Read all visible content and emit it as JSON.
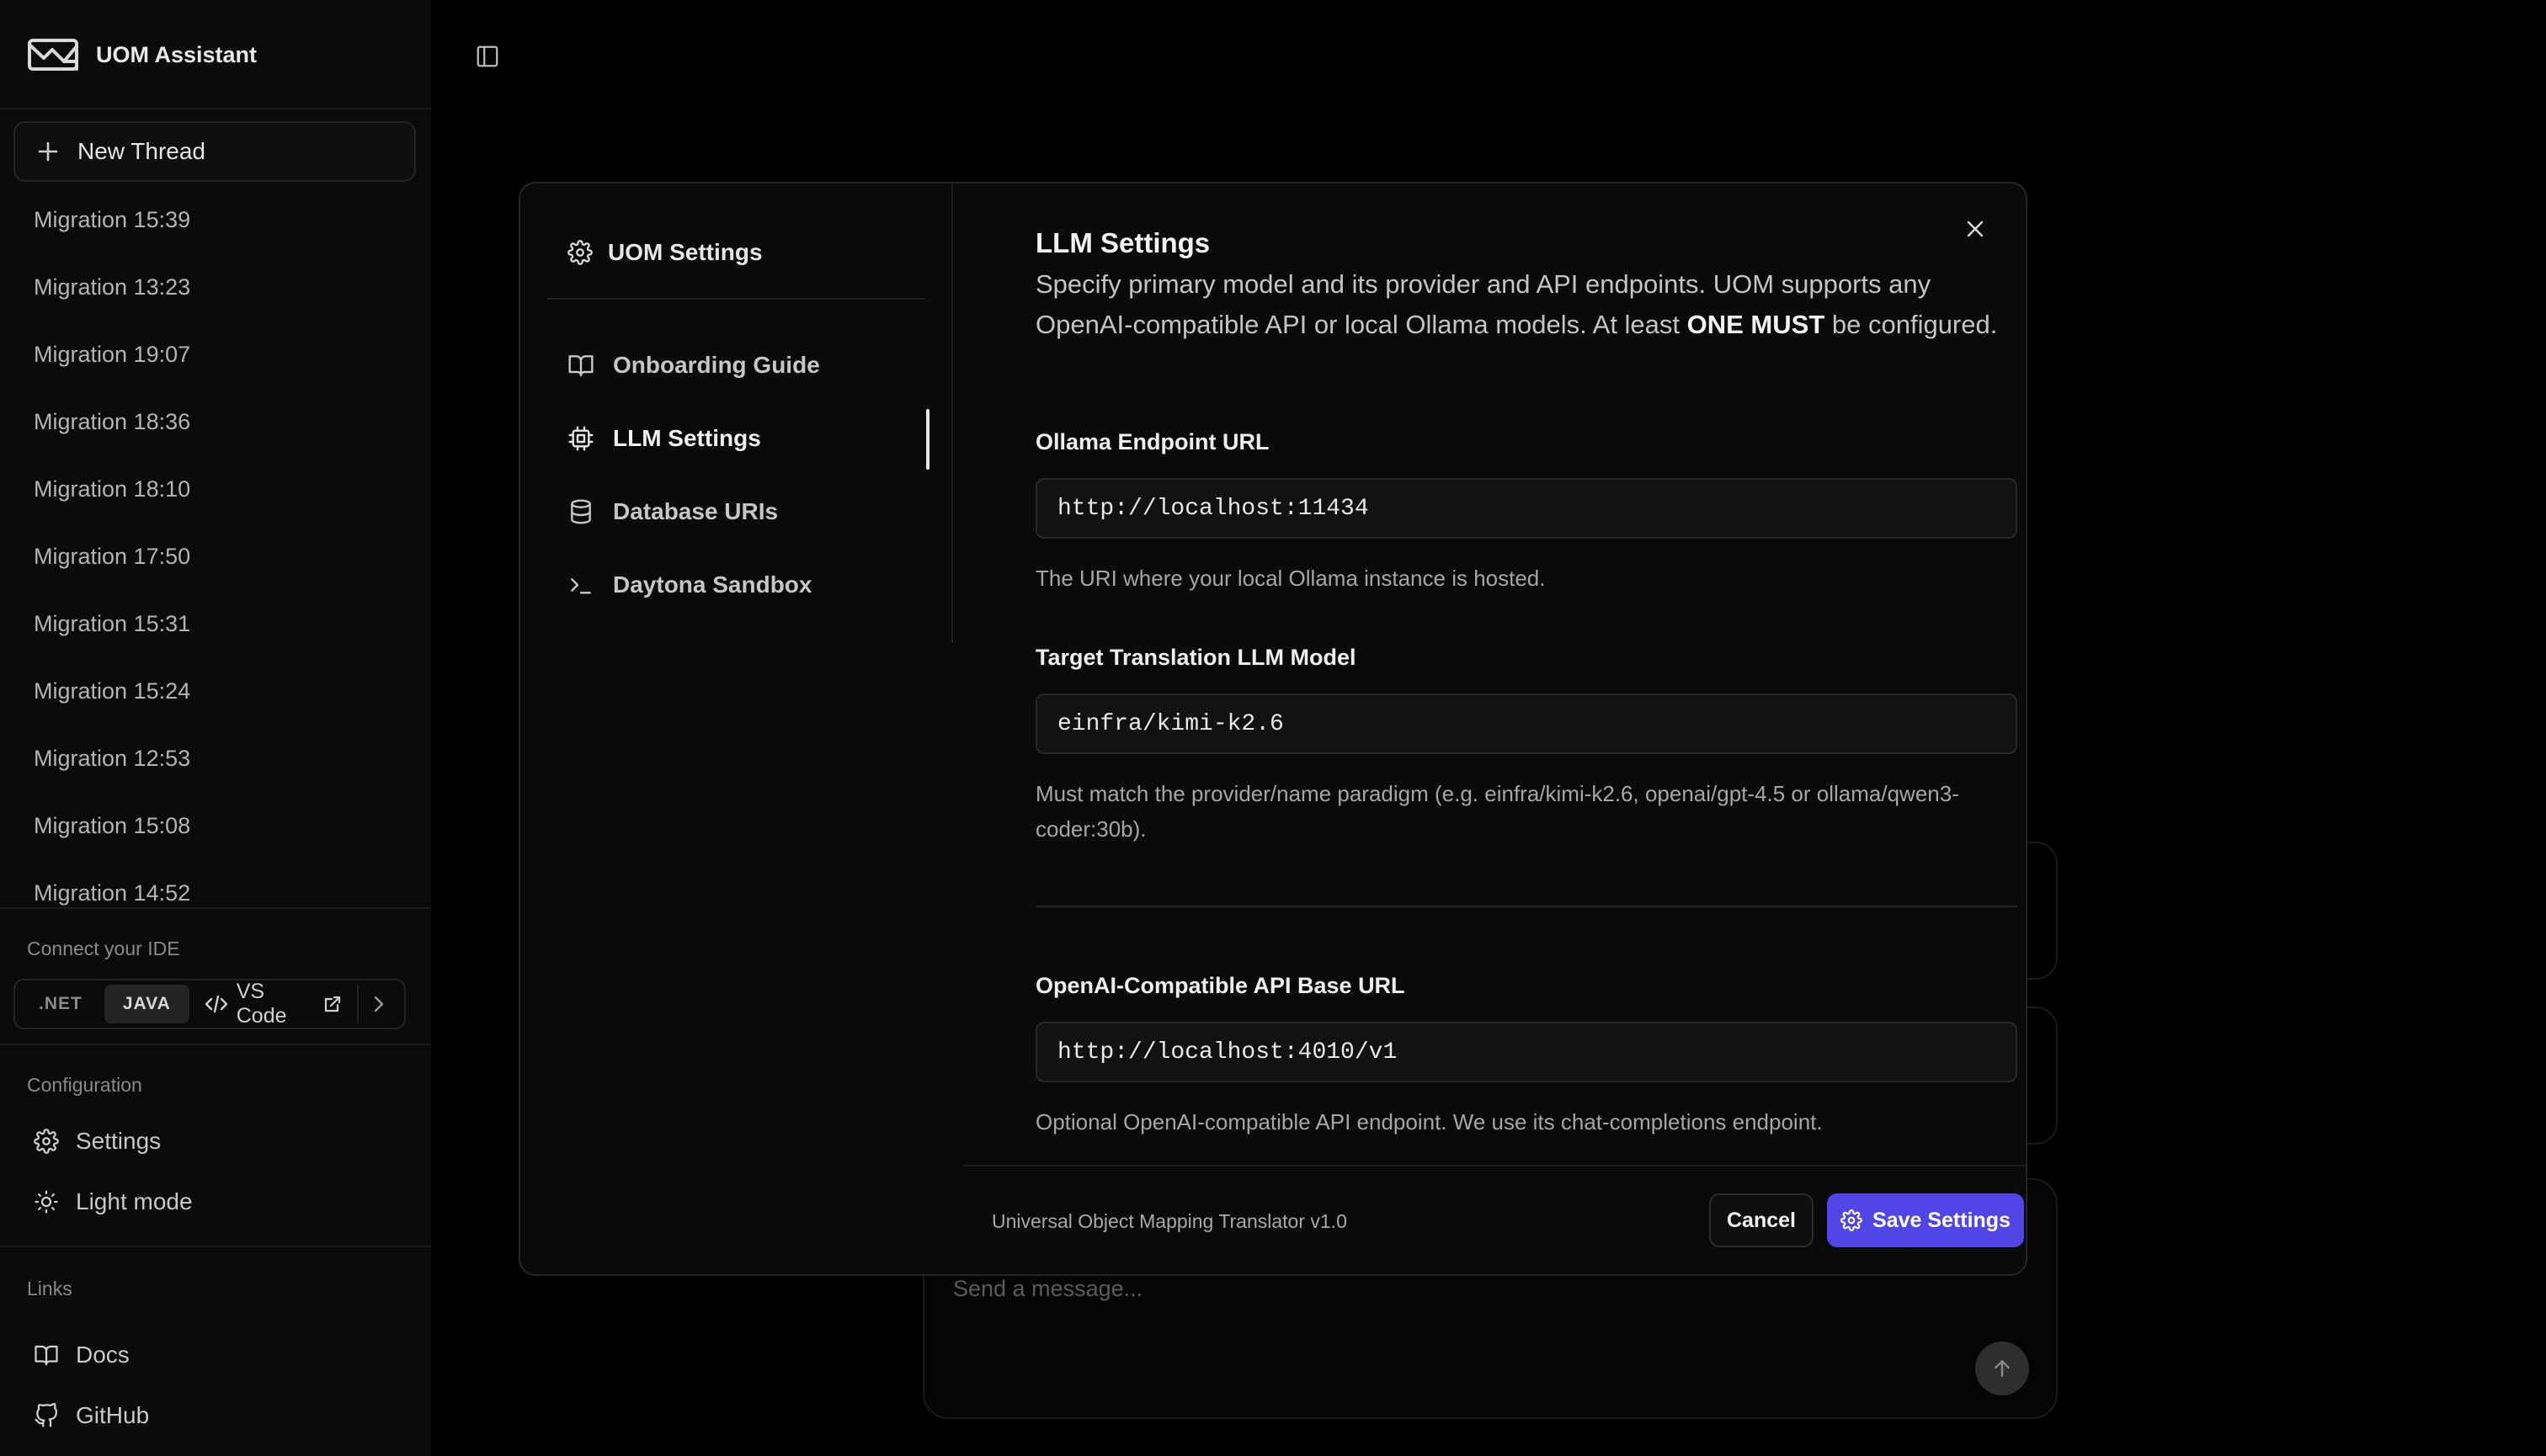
{
  "app": {
    "name": "UOM Assistant"
  },
  "sidebar": {
    "new_thread_label": "New Thread",
    "threads": [
      "Migration 15:39",
      "Migration 13:23",
      "Migration 19:07",
      "Migration 18:36",
      "Migration 18:10",
      "Migration 17:50",
      "Migration 15:31",
      "Migration 15:24",
      "Migration 12:53",
      "Migration 15:08",
      "Migration 14:52"
    ],
    "ide": {
      "section_label": "Connect your IDE",
      "options": [
        ".NET",
        "JAVA"
      ],
      "selected": "JAVA",
      "vscode_label": "VS Code"
    },
    "configuration": {
      "section_label": "Configuration",
      "settings_label": "Settings",
      "theme_label": "Light mode"
    },
    "links": {
      "section_label": "Links",
      "docs_label": "Docs",
      "github_label": "GitHub"
    }
  },
  "composer": {
    "placeholder": "Send a message..."
  },
  "modal": {
    "nav_title": "UOM Settings",
    "nav_items": [
      {
        "label": "Onboarding Guide",
        "icon": "book-icon"
      },
      {
        "label": "LLM Settings",
        "icon": "chip-icon",
        "active": true
      },
      {
        "label": "Database URIs",
        "icon": "database-icon"
      },
      {
        "label": "Daytona Sandbox",
        "icon": "terminal-icon"
      }
    ],
    "title": "LLM Settings",
    "description_pre": "Specify primary model and its provider and API endpoints. UOM supports any OpenAI-compatible API or local Ollama models. At least ",
    "description_bold": "ONE MUST",
    "description_post": " be configured.",
    "fields": {
      "ollama": {
        "label": "Ollama Endpoint URL",
        "value": "http://localhost:11434",
        "help": "The URI where your local Ollama instance is hosted."
      },
      "model": {
        "label": "Target Translation LLM Model",
        "value": "einfra/kimi-k2.6",
        "help": "Must match the provider/name paradigm (e.g. einfra/kimi-k2.6, openai/gpt-4.5 or ollama/qwen3-coder:30b)."
      },
      "openai_base": {
        "label": "OpenAI-Compatible API Base URL",
        "value": "http://localhost:4010/v1",
        "help": "Optional OpenAI-compatible API endpoint. We use its chat-completions endpoint."
      }
    },
    "footer": {
      "version": "Universal Object Mapping Translator v1.0",
      "cancel_label": "Cancel",
      "save_label": "Save Settings"
    }
  },
  "colors": {
    "accent": "#4f46e5",
    "background": "#000000",
    "sidebar_bg": "#0b0b0b",
    "modal_bg": "#0a0a0a"
  }
}
